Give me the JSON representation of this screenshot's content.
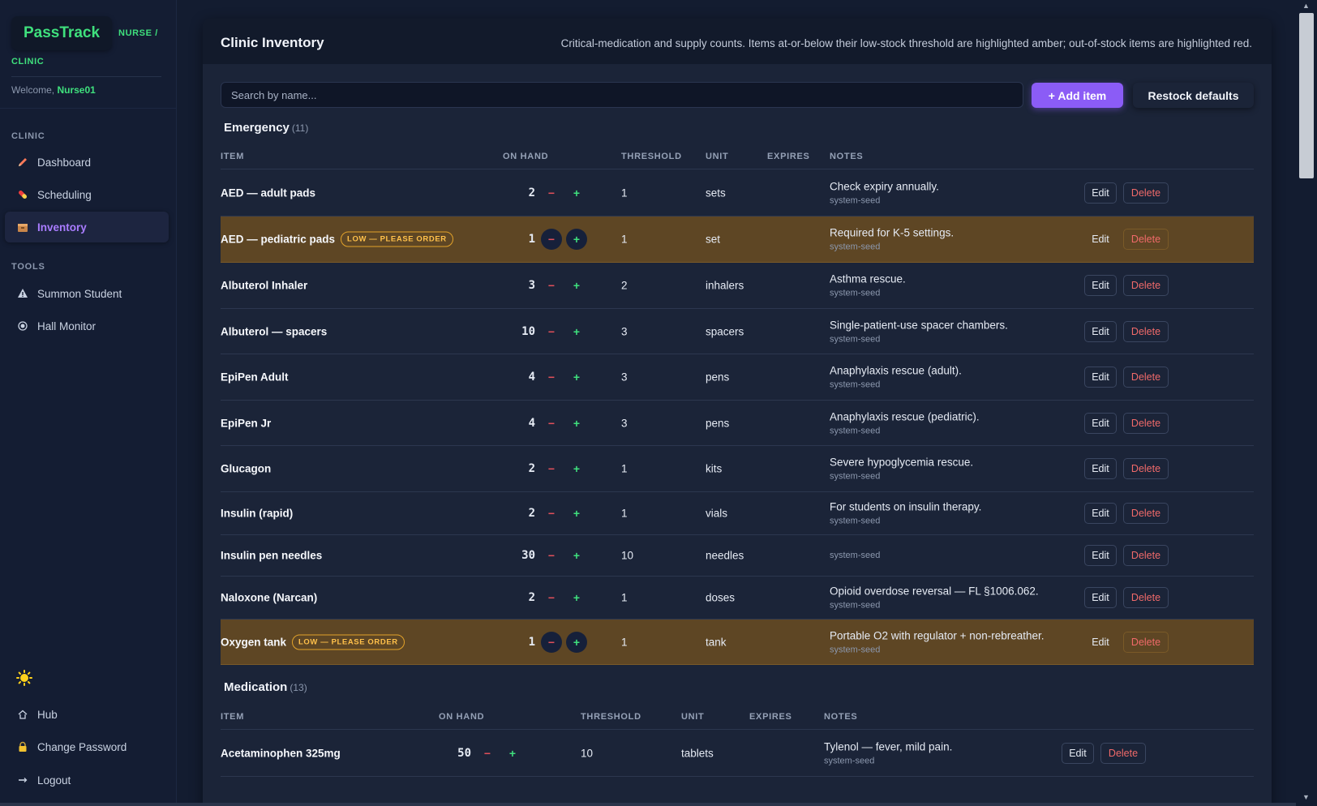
{
  "sidebar": {
    "brand": "PassTrack",
    "role_line1": "NURSE /",
    "role_line2": "CLINIC",
    "welcome_prefix": "Welcome, ",
    "welcome_user": "Nurse01",
    "section_clinic": "CLINIC",
    "section_tools": "TOOLS",
    "items": [
      {
        "label": "Dashboard",
        "icon": "pencil-icon"
      },
      {
        "label": "Scheduling",
        "icon": "pill-icon"
      },
      {
        "label": "Inventory",
        "icon": "box-icon"
      },
      {
        "label": "Summon Student",
        "icon": "warning-icon"
      },
      {
        "label": "Hall Monitor",
        "icon": "radio-dot-icon"
      },
      {
        "label": "Hub",
        "icon": "home-icon"
      },
      {
        "label": "Change Password",
        "icon": "lock-icon"
      },
      {
        "label": "Logout",
        "icon": "logout-icon"
      }
    ],
    "theme_icon": "sun-icon"
  },
  "main": {
    "title": "Clinic Inventory",
    "description": "Critical-medication and supply counts. Items at-or-below their low-stock threshold are highlighted amber; out-of-stock items are highlighted red.",
    "search_placeholder": "Search by name...",
    "add_button": "+ Add item",
    "restock_button": "Restock defaults",
    "low_badge": "LOW — PLEASE ORDER",
    "edit_label": "Edit",
    "delete_label": "Delete",
    "minus_label": "−",
    "plus_label": "+",
    "columns": [
      "ITEM",
      "ON HAND",
      "THRESHOLD",
      "UNIT",
      "EXPIRES",
      "NOTES"
    ]
  },
  "sections": [
    {
      "name": "Emergency",
      "count": "(11)",
      "rows": [
        {
          "item": "AED — adult pads",
          "on_hand": "2",
          "threshold": "1",
          "unit": "sets",
          "expires": "",
          "note": "Check expiry annually.",
          "source": "system-seed",
          "low": false
        },
        {
          "item": "AED — pediatric pads",
          "on_hand": "1",
          "threshold": "1",
          "unit": "set",
          "expires": "",
          "note": "Required for K-5 settings.",
          "source": "system-seed",
          "low": true
        },
        {
          "item": "Albuterol Inhaler",
          "on_hand": "3",
          "threshold": "2",
          "unit": "inhalers",
          "expires": "",
          "note": "Asthma rescue.",
          "source": "system-seed",
          "low": false
        },
        {
          "item": "Albuterol — spacers",
          "on_hand": "10",
          "threshold": "3",
          "unit": "spacers",
          "expires": "",
          "note": "Single-patient-use spacer chambers.",
          "source": "system-seed",
          "low": false
        },
        {
          "item": "EpiPen Adult",
          "on_hand": "4",
          "threshold": "3",
          "unit": "pens",
          "expires": "",
          "note": "Anaphylaxis rescue (adult).",
          "source": "system-seed",
          "low": false
        },
        {
          "item": "EpiPen Jr",
          "on_hand": "4",
          "threshold": "3",
          "unit": "pens",
          "expires": "",
          "note": "Anaphylaxis rescue (pediatric).",
          "source": "system-seed",
          "low": false
        },
        {
          "item": "Glucagon",
          "on_hand": "2",
          "threshold": "1",
          "unit": "kits",
          "expires": "",
          "note": "Severe hypoglycemia rescue.",
          "source": "system-seed",
          "low": false
        },
        {
          "item": "Insulin (rapid)",
          "on_hand": "2",
          "threshold": "1",
          "unit": "vials",
          "expires": "",
          "note": "For students on insulin therapy.",
          "source": "system-seed",
          "low": false
        },
        {
          "item": "Insulin pen needles",
          "on_hand": "30",
          "threshold": "10",
          "unit": "needles",
          "expires": "",
          "note": "",
          "source": "system-seed",
          "low": false
        },
        {
          "item": "Naloxone (Narcan)",
          "on_hand": "2",
          "threshold": "1",
          "unit": "doses",
          "expires": "",
          "note": "Opioid overdose reversal — FL §1006.062.",
          "source": "system-seed",
          "low": false
        },
        {
          "item": "Oxygen tank",
          "on_hand": "1",
          "threshold": "1",
          "unit": "tank",
          "expires": "",
          "note": "Portable O2 with regulator + non-rebreather.",
          "source": "system-seed",
          "low": true
        }
      ]
    },
    {
      "name": "Medication",
      "count": "(13)",
      "rows": [
        {
          "item": "Acetaminophen 325mg",
          "on_hand": "50",
          "threshold": "10",
          "unit": "tablets",
          "expires": "",
          "note": "Tylenol — fever, mild pain.",
          "source": "system-seed",
          "low": false
        }
      ]
    }
  ],
  "colors": {
    "accent": "#8b5cf6",
    "brand_green": "#3fe07d",
    "low_row": "#5e4624",
    "low_badge": "#ffc04a",
    "delete_red": "#f06a6a"
  }
}
